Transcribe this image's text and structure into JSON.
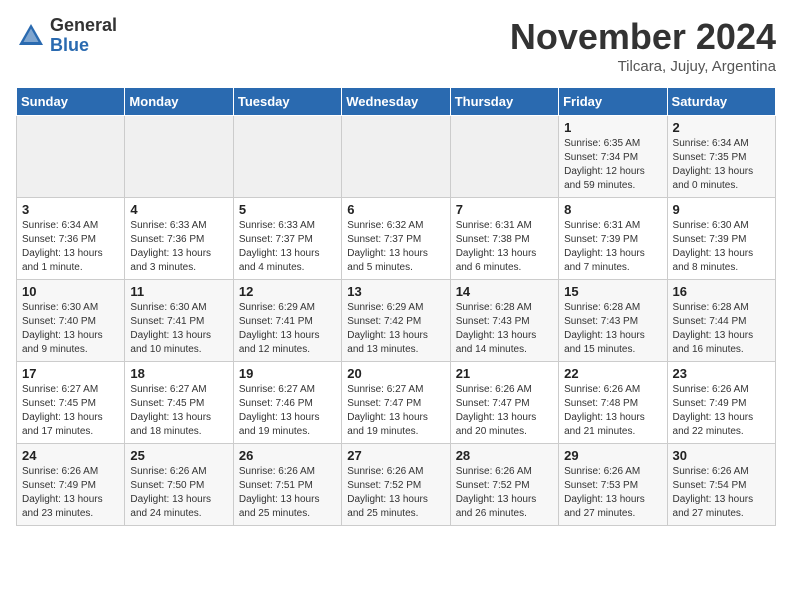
{
  "logo": {
    "general": "General",
    "blue": "Blue"
  },
  "title": "November 2024",
  "subtitle": "Tilcara, Jujuy, Argentina",
  "days_header": [
    "Sunday",
    "Monday",
    "Tuesday",
    "Wednesday",
    "Thursday",
    "Friday",
    "Saturday"
  ],
  "weeks": [
    [
      {
        "day": "",
        "info": ""
      },
      {
        "day": "",
        "info": ""
      },
      {
        "day": "",
        "info": ""
      },
      {
        "day": "",
        "info": ""
      },
      {
        "day": "",
        "info": ""
      },
      {
        "day": "1",
        "info": "Sunrise: 6:35 AM\nSunset: 7:34 PM\nDaylight: 12 hours and 59 minutes."
      },
      {
        "day": "2",
        "info": "Sunrise: 6:34 AM\nSunset: 7:35 PM\nDaylight: 13 hours and 0 minutes."
      }
    ],
    [
      {
        "day": "3",
        "info": "Sunrise: 6:34 AM\nSunset: 7:36 PM\nDaylight: 13 hours and 1 minute."
      },
      {
        "day": "4",
        "info": "Sunrise: 6:33 AM\nSunset: 7:36 PM\nDaylight: 13 hours and 3 minutes."
      },
      {
        "day": "5",
        "info": "Sunrise: 6:33 AM\nSunset: 7:37 PM\nDaylight: 13 hours and 4 minutes."
      },
      {
        "day": "6",
        "info": "Sunrise: 6:32 AM\nSunset: 7:37 PM\nDaylight: 13 hours and 5 minutes."
      },
      {
        "day": "7",
        "info": "Sunrise: 6:31 AM\nSunset: 7:38 PM\nDaylight: 13 hours and 6 minutes."
      },
      {
        "day": "8",
        "info": "Sunrise: 6:31 AM\nSunset: 7:39 PM\nDaylight: 13 hours and 7 minutes."
      },
      {
        "day": "9",
        "info": "Sunrise: 6:30 AM\nSunset: 7:39 PM\nDaylight: 13 hours and 8 minutes."
      }
    ],
    [
      {
        "day": "10",
        "info": "Sunrise: 6:30 AM\nSunset: 7:40 PM\nDaylight: 13 hours and 9 minutes."
      },
      {
        "day": "11",
        "info": "Sunrise: 6:30 AM\nSunset: 7:41 PM\nDaylight: 13 hours and 10 minutes."
      },
      {
        "day": "12",
        "info": "Sunrise: 6:29 AM\nSunset: 7:41 PM\nDaylight: 13 hours and 12 minutes."
      },
      {
        "day": "13",
        "info": "Sunrise: 6:29 AM\nSunset: 7:42 PM\nDaylight: 13 hours and 13 minutes."
      },
      {
        "day": "14",
        "info": "Sunrise: 6:28 AM\nSunset: 7:43 PM\nDaylight: 13 hours and 14 minutes."
      },
      {
        "day": "15",
        "info": "Sunrise: 6:28 AM\nSunset: 7:43 PM\nDaylight: 13 hours and 15 minutes."
      },
      {
        "day": "16",
        "info": "Sunrise: 6:28 AM\nSunset: 7:44 PM\nDaylight: 13 hours and 16 minutes."
      }
    ],
    [
      {
        "day": "17",
        "info": "Sunrise: 6:27 AM\nSunset: 7:45 PM\nDaylight: 13 hours and 17 minutes."
      },
      {
        "day": "18",
        "info": "Sunrise: 6:27 AM\nSunset: 7:45 PM\nDaylight: 13 hours and 18 minutes."
      },
      {
        "day": "19",
        "info": "Sunrise: 6:27 AM\nSunset: 7:46 PM\nDaylight: 13 hours and 19 minutes."
      },
      {
        "day": "20",
        "info": "Sunrise: 6:27 AM\nSunset: 7:47 PM\nDaylight: 13 hours and 19 minutes."
      },
      {
        "day": "21",
        "info": "Sunrise: 6:26 AM\nSunset: 7:47 PM\nDaylight: 13 hours and 20 minutes."
      },
      {
        "day": "22",
        "info": "Sunrise: 6:26 AM\nSunset: 7:48 PM\nDaylight: 13 hours and 21 minutes."
      },
      {
        "day": "23",
        "info": "Sunrise: 6:26 AM\nSunset: 7:49 PM\nDaylight: 13 hours and 22 minutes."
      }
    ],
    [
      {
        "day": "24",
        "info": "Sunrise: 6:26 AM\nSunset: 7:49 PM\nDaylight: 13 hours and 23 minutes."
      },
      {
        "day": "25",
        "info": "Sunrise: 6:26 AM\nSunset: 7:50 PM\nDaylight: 13 hours and 24 minutes."
      },
      {
        "day": "26",
        "info": "Sunrise: 6:26 AM\nSunset: 7:51 PM\nDaylight: 13 hours and 25 minutes."
      },
      {
        "day": "27",
        "info": "Sunrise: 6:26 AM\nSunset: 7:52 PM\nDaylight: 13 hours and 25 minutes."
      },
      {
        "day": "28",
        "info": "Sunrise: 6:26 AM\nSunset: 7:52 PM\nDaylight: 13 hours and 26 minutes."
      },
      {
        "day": "29",
        "info": "Sunrise: 6:26 AM\nSunset: 7:53 PM\nDaylight: 13 hours and 27 minutes."
      },
      {
        "day": "30",
        "info": "Sunrise: 6:26 AM\nSunset: 7:54 PM\nDaylight: 13 hours and 27 minutes."
      }
    ]
  ]
}
